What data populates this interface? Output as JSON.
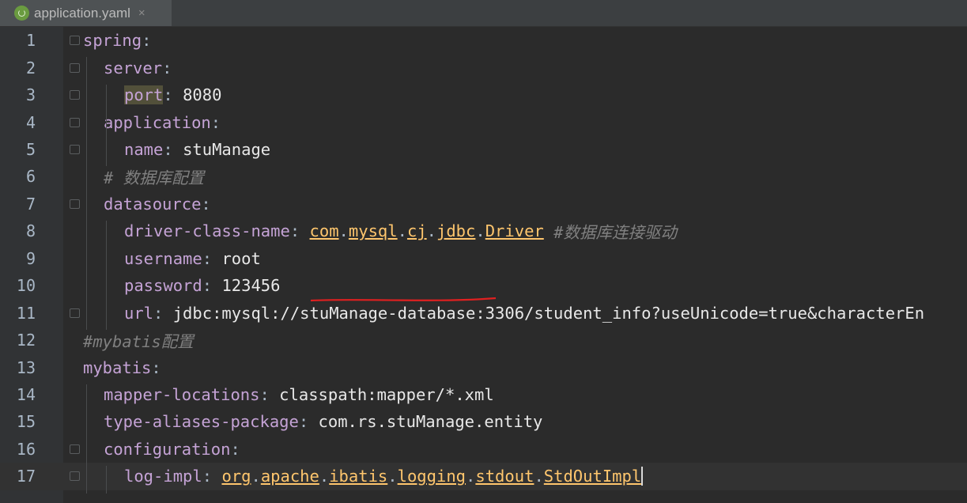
{
  "tab": {
    "title": "application.yaml",
    "close": "×"
  },
  "lines": [
    {
      "n": "1",
      "indent": 0,
      "parts": [
        {
          "t": "spring",
          "c": "k"
        },
        {
          "t": ":",
          "c": "p"
        }
      ]
    },
    {
      "n": "2",
      "indent": 1,
      "parts": [
        {
          "t": "server",
          "c": "k"
        },
        {
          "t": ":",
          "c": "p"
        }
      ]
    },
    {
      "n": "3",
      "indent": 2,
      "parts": [
        {
          "t": "port",
          "c": "k hl"
        },
        {
          "t": ": ",
          "c": "p"
        },
        {
          "t": "8080",
          "c": "v"
        }
      ]
    },
    {
      "n": "4",
      "indent": 1,
      "parts": [
        {
          "t": "application",
          "c": "k"
        },
        {
          "t": ":",
          "c": "p"
        }
      ]
    },
    {
      "n": "5",
      "indent": 2,
      "parts": [
        {
          "t": "name",
          "c": "k"
        },
        {
          "t": ": ",
          "c": "p"
        },
        {
          "t": "stuManage",
          "c": "v"
        }
      ]
    },
    {
      "n": "6",
      "indent": 1,
      "parts": [
        {
          "t": "# 数据库配置",
          "c": "cmt"
        }
      ]
    },
    {
      "n": "7",
      "indent": 1,
      "parts": [
        {
          "t": "datasource",
          "c": "k"
        },
        {
          "t": ":",
          "c": "p"
        }
      ]
    },
    {
      "n": "8",
      "indent": 2,
      "parts": [
        {
          "t": "driver-class-name",
          "c": "k"
        },
        {
          "t": ": ",
          "c": "p"
        },
        {
          "t": "com",
          "c": "cls"
        },
        {
          "t": ".",
          "c": "dot"
        },
        {
          "t": "mysql",
          "c": "cls"
        },
        {
          "t": ".",
          "c": "dot"
        },
        {
          "t": "cj",
          "c": "cls"
        },
        {
          "t": ".",
          "c": "dot"
        },
        {
          "t": "jdbc",
          "c": "cls"
        },
        {
          "t": ".",
          "c": "dot"
        },
        {
          "t": "Driver",
          "c": "cls"
        },
        {
          "t": " ",
          "c": "p"
        },
        {
          "t": "#数据库连接驱动",
          "c": "cmt"
        }
      ]
    },
    {
      "n": "9",
      "indent": 2,
      "parts": [
        {
          "t": "username",
          "c": "k"
        },
        {
          "t": ": ",
          "c": "p"
        },
        {
          "t": "root",
          "c": "v"
        }
      ]
    },
    {
      "n": "10",
      "indent": 2,
      "parts": [
        {
          "t": "password",
          "c": "k"
        },
        {
          "t": ": ",
          "c": "p"
        },
        {
          "t": "123456",
          "c": "v"
        }
      ]
    },
    {
      "n": "11",
      "indent": 2,
      "parts": [
        {
          "t": "url",
          "c": "k"
        },
        {
          "t": ": ",
          "c": "p"
        },
        {
          "t": "jdbc:mysql://stuManage-database:3306/student_info?useUnicode=true&characterEn",
          "c": "v"
        }
      ]
    },
    {
      "n": "12",
      "indent": 0,
      "parts": [
        {
          "t": "#mybatis配置",
          "c": "cmt"
        }
      ]
    },
    {
      "n": "13",
      "indent": 0,
      "parts": [
        {
          "t": "mybatis",
          "c": "k"
        },
        {
          "t": ":",
          "c": "p"
        }
      ]
    },
    {
      "n": "14",
      "indent": 1,
      "parts": [
        {
          "t": "mapper-locations",
          "c": "k"
        },
        {
          "t": ": ",
          "c": "p"
        },
        {
          "t": "classpath:mapper/*.xml",
          "c": "v"
        }
      ]
    },
    {
      "n": "15",
      "indent": 1,
      "parts": [
        {
          "t": "type-aliases-package",
          "c": "k"
        },
        {
          "t": ": ",
          "c": "p"
        },
        {
          "t": "com.rs.stuManage.entity",
          "c": "v"
        }
      ]
    },
    {
      "n": "16",
      "indent": 1,
      "parts": [
        {
          "t": "configuration",
          "c": "k"
        },
        {
          "t": ":",
          "c": "p"
        }
      ]
    },
    {
      "n": "17",
      "indent": 2,
      "current": true,
      "parts": [
        {
          "t": "log-impl",
          "c": "k"
        },
        {
          "t": ": ",
          "c": "p"
        },
        {
          "t": "org",
          "c": "cls"
        },
        {
          "t": ".",
          "c": "dot"
        },
        {
          "t": "apache",
          "c": "cls"
        },
        {
          "t": ".",
          "c": "dot"
        },
        {
          "t": "ibatis",
          "c": "cls"
        },
        {
          "t": ".",
          "c": "dot"
        },
        {
          "t": "logging",
          "c": "cls"
        },
        {
          "t": ".",
          "c": "dot"
        },
        {
          "t": "stdout",
          "c": "cls"
        },
        {
          "t": ".",
          "c": "dot"
        },
        {
          "t": "StdOutImpl",
          "c": "cls"
        }
      ]
    }
  ],
  "annotation": {
    "underlined_text": "stuManage-database",
    "color": "#e02020"
  },
  "colors": {
    "background": "#2b2b2b",
    "key": "#c5a3d6",
    "class_ref": "#ffc66d",
    "comment": "#808080"
  }
}
